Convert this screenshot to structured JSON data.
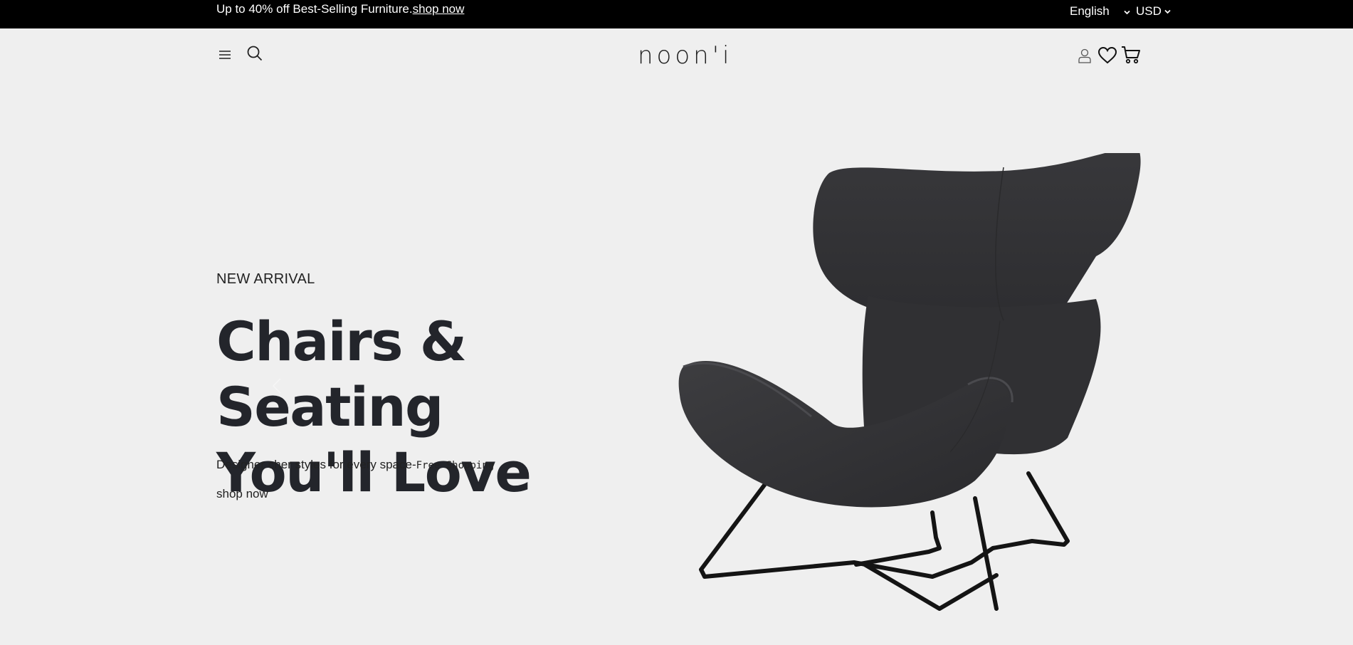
{
  "announcement": {
    "text": "Up to 40% off Best-Selling Furniture.",
    "link": "shop now"
  },
  "locale": {
    "language": "English",
    "currency": "USD"
  },
  "header": {
    "logo": "noon'i"
  },
  "icons": {
    "menu": "hamburger-menu-icon",
    "search": "search-icon",
    "account": "user-icon",
    "wishlist": "heart-icon",
    "cart": "cart-icon"
  },
  "hero": {
    "eyebrow": "NEW ARRIVAL",
    "headline_line1": "Chairs & Seating",
    "headline_line2": "You'll Love",
    "description": "Designer cher styles for every space-",
    "description_mono": "Free Shopping",
    "cta": "shop now",
    "image": "black-lounge-chair"
  },
  "colors": {
    "background": "#efefef",
    "topbar": "#000000",
    "text": "#23252b"
  }
}
